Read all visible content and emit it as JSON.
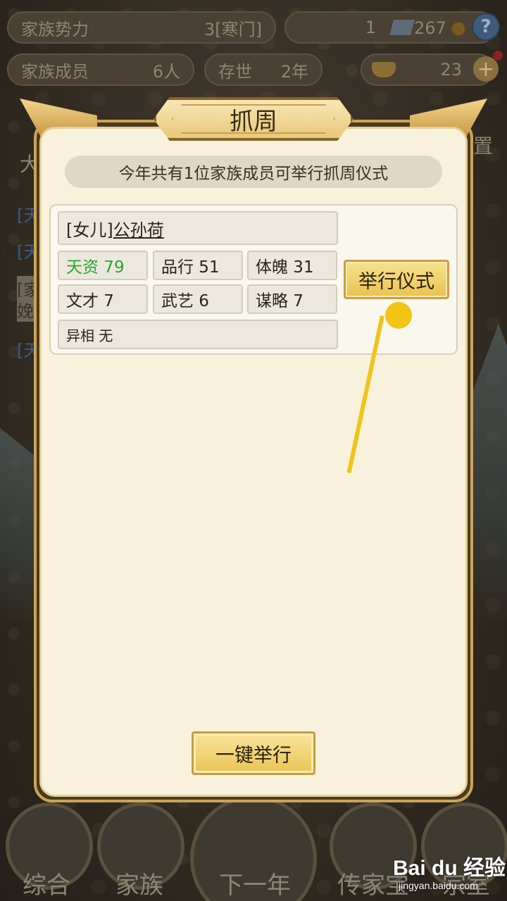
{
  "topbar": {
    "clan_power_label": "家族势力",
    "clan_power_value": "3[寒门]",
    "currency_silver": "1",
    "currency_coins": "267",
    "members_label": "家族成员",
    "members_value": "6人",
    "existence_label": "存世",
    "existence_value": "2年",
    "gold_value": "23"
  },
  "background_side_text": {
    "t1": "[天",
    "t2": "[天",
    "t3": "[家",
    "t4": "娩",
    "t5": "[天",
    "t6": "大",
    "t7": "置"
  },
  "modal": {
    "title": "抓周",
    "notice": "今年共有1位家族成员可举行抓周仪式",
    "member": {
      "relation": "[女儿]",
      "name": "公孙荷",
      "stats": [
        {
          "label": "天资 79"
        },
        {
          "label": "品行 51"
        },
        {
          "label": "体魄 31"
        },
        {
          "label": "文才 7"
        },
        {
          "label": "武艺 6"
        },
        {
          "label": "谋略 7"
        }
      ],
      "trait": "异相 无"
    },
    "hold_ceremony_label": "举行仪式",
    "one_key_label": "一键举行"
  },
  "bottom_nav": {
    "items": [
      {
        "label": "综合"
      },
      {
        "label": "家族"
      },
      {
        "label": "下一年"
      },
      {
        "label": "传家宝"
      },
      {
        "label": "宗室"
      }
    ]
  },
  "watermark": {
    "brand": "Bai du 经验",
    "url": "jingyan.baidu.com"
  },
  "colors": {
    "accent_gold": "#e8c250",
    "talent_green": "#28a82a",
    "highlight_yellow": "#f2c414"
  }
}
